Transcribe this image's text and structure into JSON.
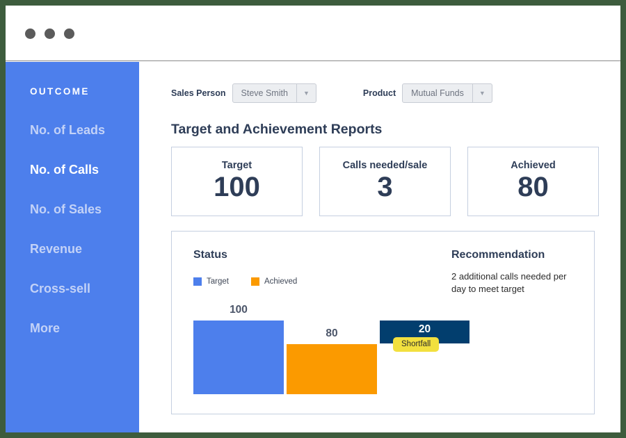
{
  "window": {
    "frame_color": "#3d5c3d",
    "dots": [
      "window-dot-1",
      "window-dot-2",
      "window-dot-3"
    ]
  },
  "sidebar": {
    "title": "OUTCOME",
    "accent_color": "#4d7fec",
    "items": [
      {
        "label": "No. of Leads",
        "active": false
      },
      {
        "label": "No. of Calls",
        "active": true
      },
      {
        "label": "No. of Sales",
        "active": false
      },
      {
        "label": "Revenue",
        "active": false
      },
      {
        "label": "Cross-sell",
        "active": false
      },
      {
        "label": "More",
        "active": false
      }
    ]
  },
  "filters": {
    "sales_person": {
      "label": "Sales Person",
      "value": "Steve Smith",
      "arrow_icon": "chevron-down-icon"
    },
    "product": {
      "label": "Product",
      "value": "Mutual Funds",
      "arrow_icon": "chevron-down-icon"
    }
  },
  "main": {
    "page_title": "Target and Achievement Reports",
    "kpis": [
      {
        "label": "Target",
        "value": "100"
      },
      {
        "label": "Calls needed/sale",
        "value": "3"
      },
      {
        "label": "Achieved",
        "value": "80"
      }
    ],
    "status": {
      "heading": "Status",
      "legend": [
        {
          "label": "Target",
          "color": "#4d7fec"
        },
        {
          "label": "Achieved",
          "color": "#fb9a00"
        }
      ]
    },
    "recommendation": {
      "heading": "Recommendation",
      "body": "2 additional calls needed per day to meet target"
    }
  },
  "chart_data": {
    "type": "bar",
    "title": "Status",
    "xlabel": "",
    "ylabel": "",
    "grid": false,
    "legend_position": "top-left",
    "categories": [
      "Target",
      "Achieved",
      "Shortfall"
    ],
    "values": [
      100,
      80,
      20
    ],
    "value_labels": [
      "100",
      "80",
      "20"
    ],
    "colors": [
      "#4d7fec",
      "#fb9a00",
      "#023e6e"
    ],
    "ylim": [
      0,
      100
    ],
    "annotations": [
      {
        "text": "Shortfall",
        "attached_to": "Shortfall",
        "background": "#f2e03f",
        "text_color": "#2b2b2b"
      }
    ],
    "notes": "Shortfall bar is stacked on top of the Achieved level (80 to 100)."
  }
}
